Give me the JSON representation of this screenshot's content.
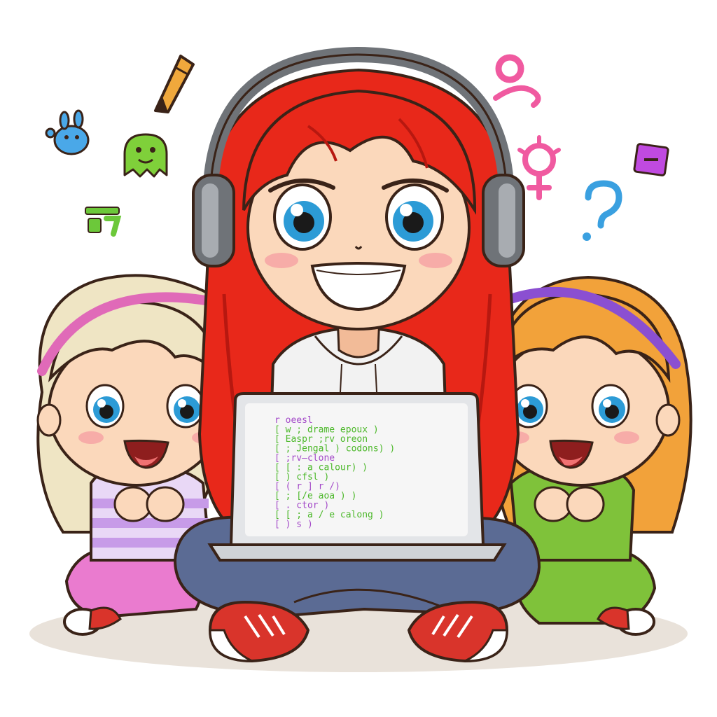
{
  "colors": {
    "background": "#ffffff",
    "outline": "#3a2318",
    "skin": "#fbd8bb",
    "skin_shadow": "#f2bb98",
    "blush": "#f59aa0",
    "red_hair": "#e8281a",
    "red_hair_dark": "#b71810",
    "blonde_hair": "#efe5c4",
    "orange_hair": "#f2a23a",
    "headphones": "#6f7378",
    "headphones_light": "#a8acb1",
    "hoodie": "#f2f2f2",
    "jeans": "#5b6b94",
    "laptop": "#e3e5e8",
    "laptop_screen": "#f6f6f6",
    "code_purple": "#a349c8",
    "code_green": "#4cb82a",
    "code_orange": "#f07a1e",
    "pink_outfit": "#ea7bcf",
    "striped_shirt": "#c79be8",
    "green_outfit": "#7fc23a",
    "sneakers": "#d9342b",
    "eyes": "#2c9bd6",
    "pink_headband": "#e06ab8",
    "purple_headband": "#8b4fd1"
  },
  "laptop_code": {
    "lines": [
      {
        "text": "r oeesl",
        "color": "#a349c8"
      },
      {
        "text": "[ w  ;  drame  epoux )",
        "color": "#4cb82a"
      },
      {
        "text": "[       Easpr ;rv oreon",
        "color": "#4cb82a"
      },
      {
        "text": "[  ;  Jengal )  codons)  )",
        "color": "#4cb82a"
      },
      {
        "text": "[     ;rv—clone",
        "color": "#a349c8"
      },
      {
        "text": "[       [ : a  calour) )",
        "color": "#4cb82a"
      },
      {
        "text": "[              ) cfsl )",
        "color": "#4cb82a"
      },
      {
        "text": "[     ( r  ] r  /)",
        "color": "#a349c8"
      },
      {
        "text": "[       ;  [/e   aoa )  )",
        "color": "#4cb82a"
      },
      {
        "text": "[          .   ctor )",
        "color": "#a349c8"
      },
      {
        "text": "[         [  ; a  / e  calong )",
        "color": "#4cb82a"
      },
      {
        "text": "[   ) s )",
        "color": "#a349c8"
      }
    ]
  },
  "floating_icons": [
    {
      "name": "pencil-icon",
      "color": "#f0a83c"
    },
    {
      "name": "blue-bunny-icon",
      "color": "#4aa8e8"
    },
    {
      "name": "green-octopus-icon",
      "color": "#7fd03a"
    },
    {
      "name": "green-glyph-icon",
      "color": "#6cc83a"
    },
    {
      "name": "pink-curl-glyph-icon",
      "color": "#f05aa0"
    },
    {
      "name": "pink-gender-symbol-icon",
      "color": "#f05aa0"
    },
    {
      "name": "blue-question-mark-icon",
      "color": "#3aa0e0"
    },
    {
      "name": "purple-square-icon",
      "color": "#c04ae0"
    }
  ]
}
